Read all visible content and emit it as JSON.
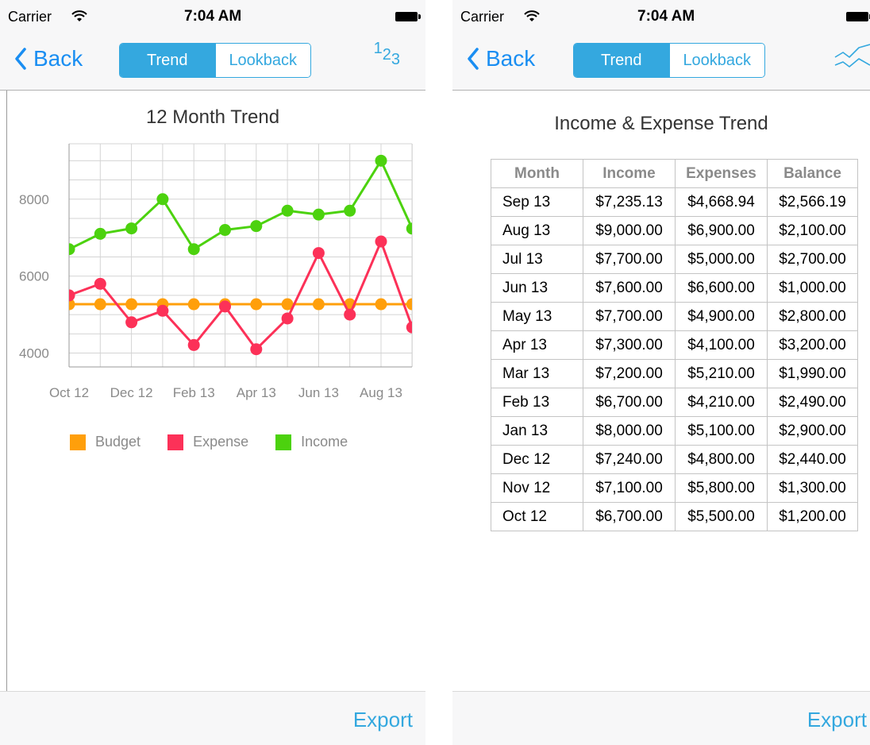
{
  "status": {
    "carrier": "Carrier",
    "time": "7:04 AM"
  },
  "nav": {
    "back": "Back",
    "segment_trend": "Trend",
    "segment_lookback": "Lookback",
    "left_right_icon": "number-icon",
    "right_right_icon": "trend-chart-icon",
    "number_icon_digits": [
      "1",
      "2",
      "3"
    ]
  },
  "toolbar": {
    "export": "Export"
  },
  "colors": {
    "accent": "#34a8df",
    "budget": "#ff9f0b",
    "expense": "#fc3158",
    "income": "#4cd20e"
  },
  "legend": [
    {
      "label": "Budget",
      "color": "#ff9f0b"
    },
    {
      "label": "Expense",
      "color": "#fc3158"
    },
    {
      "label": "Income",
      "color": "#4cd20e"
    }
  ],
  "chart_data": {
    "type": "line",
    "title": "12 Month Trend",
    "x": [
      "Oct 12",
      "Nov 12",
      "Dec 12",
      "Jan 13",
      "Feb 13",
      "Mar 13",
      "Apr 13",
      "May 13",
      "Jun 13",
      "Jul 13",
      "Aug 13",
      "Sep 13"
    ],
    "x_tick_labels": [
      "Oct 12",
      "Dec 12",
      "Feb 13",
      "Apr 13",
      "Jun 13",
      "Aug 13"
    ],
    "y_ticks": [
      4000,
      6000,
      8000
    ],
    "ylim": [
      3640,
      9440
    ],
    "grid": true,
    "legend_position": "bottom",
    "series": [
      {
        "name": "Budget",
        "color": "#ff9f0b",
        "values": [
          5270,
          5270,
          5270,
          5270,
          5270,
          5270,
          5270,
          5270,
          5270,
          5270,
          5270,
          5270
        ]
      },
      {
        "name": "Expense",
        "color": "#fc3158",
        "values": [
          5500,
          5800,
          4800,
          5100,
          4210,
          5210,
          4100,
          4900,
          6600,
          5000,
          6900,
          4668.94
        ]
      },
      {
        "name": "Income",
        "color": "#4cd20e",
        "values": [
          6700,
          7100,
          7240,
          8000,
          6700,
          7200,
          7300,
          7700,
          7600,
          7700,
          9000,
          7235.13
        ]
      }
    ]
  },
  "table": {
    "title": "Income & Expense Trend",
    "columns": [
      "Month",
      "Income",
      "Expenses",
      "Balance"
    ],
    "rows": [
      [
        "Sep 13",
        "$7,235.13",
        "$4,668.94",
        "$2,566.19"
      ],
      [
        "Aug 13",
        "$9,000.00",
        "$6,900.00",
        "$2,100.00"
      ],
      [
        "Jul 13",
        "$7,700.00",
        "$5,000.00",
        "$2,700.00"
      ],
      [
        "Jun 13",
        "$7,600.00",
        "$6,600.00",
        "$1,000.00"
      ],
      [
        "May 13",
        "$7,700.00",
        "$4,900.00",
        "$2,800.00"
      ],
      [
        "Apr 13",
        "$7,300.00",
        "$4,100.00",
        "$3,200.00"
      ],
      [
        "Mar 13",
        "$7,200.00",
        "$5,210.00",
        "$1,990.00"
      ],
      [
        "Feb 13",
        "$6,700.00",
        "$4,210.00",
        "$2,490.00"
      ],
      [
        "Jan 13",
        "$8,000.00",
        "$5,100.00",
        "$2,900.00"
      ],
      [
        "Dec 12",
        "$7,240.00",
        "$4,800.00",
        "$2,440.00"
      ],
      [
        "Nov 12",
        "$7,100.00",
        "$5,800.00",
        "$1,300.00"
      ],
      [
        "Oct 12",
        "$6,700.00",
        "$5,500.00",
        "$1,200.00"
      ]
    ]
  }
}
